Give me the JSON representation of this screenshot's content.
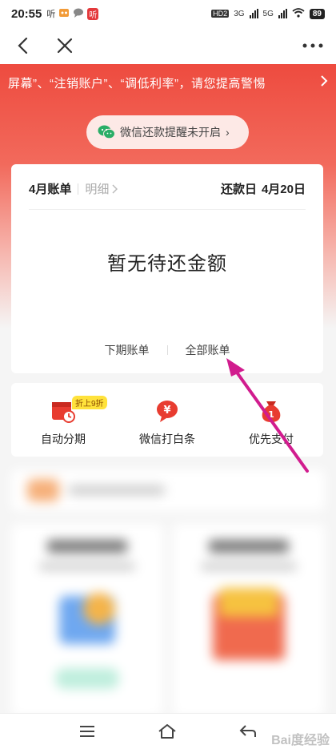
{
  "status_bar": {
    "time": "20:55",
    "app_badges": [
      "听",
      "听"
    ],
    "network": [
      "HD2",
      "3G",
      "5G"
    ],
    "battery": "89"
  },
  "nav": {
    "back_icon": "chevron-left-icon",
    "close_icon": "close-icon",
    "more_icon": "more-dots-icon"
  },
  "marquee": {
    "text": "屏幕”、“注销账户”、“调低利率”，请您提高警惕",
    "arrow": "›"
  },
  "wechat_reminder": {
    "label": "微信还款提醒未开启",
    "arrow": "›"
  },
  "bill": {
    "month_label": "4月账单",
    "detail_label": "明细",
    "repay_label": "还款日",
    "repay_date": "4月20日",
    "empty_amount": "暂无待还金额",
    "next_bill": "下期账单",
    "all_bills": "全部账单"
  },
  "quick_actions": [
    {
      "label": "自动分期",
      "icon": "installment-icon",
      "badge": "折上9折",
      "color": "#e83c30"
    },
    {
      "label": "微信打白条",
      "icon": "wechat-baitiao-icon",
      "color": "#e83c30"
    },
    {
      "label": "优先支付",
      "icon": "priority-pay-icon",
      "color": "#e83c30"
    }
  ],
  "bottom_nav": {
    "menu_icon": "menu-icon",
    "home_icon": "home-icon",
    "back_icon": "back-icon"
  },
  "watermark": "Bai度经验",
  "colors": {
    "accent": "#e83c30",
    "hero_top": "#ee4b3f",
    "annotation_arrow": "#d11c8e"
  }
}
